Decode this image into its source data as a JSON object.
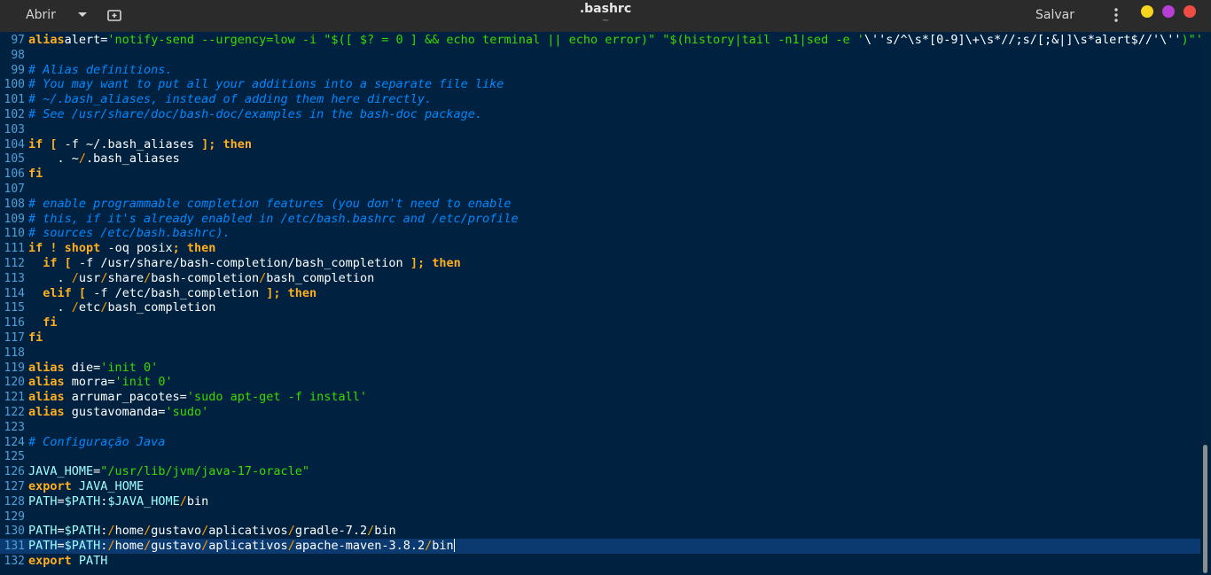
{
  "header": {
    "open_label": "Abrir",
    "title": ".bashrc",
    "subtitle": "~",
    "save_label": "Salvar",
    "icons": {
      "dropdown": "chevron-down-icon",
      "new_tab": "new-tab-icon",
      "menu": "vertical-dots-menu-icon"
    },
    "window_colors": {
      "minimize": "#f5d51d",
      "maximize": "#b73ed6",
      "close": "#ee4d45"
    }
  },
  "editor": {
    "colors": {
      "background": "#002240",
      "keyword": "#ffae1f",
      "string": "#3ad900",
      "comment": "#0088ff",
      "line_number": "#4fa0d8",
      "current_line": "#0b3a70"
    },
    "current_line": 131,
    "lines": [
      {
        "n": "97",
        "segs": [
          [
            "k",
            "alias"
          ],
          [
            "",
            "alert="
          ],
          [
            "s",
            "'notify-send --urgency=low -i \"$([ $? = 0 ] && echo terminal || echo error)\" \"$(history|tail -n1|sed -e '"
          ],
          [
            "",
            "\\''s/^\\s*[0-9]\\+\\s*//;s/[;&|]\\s*alert$//'\\''"
          ],
          [
            "s",
            ")\"'"
          ]
        ]
      },
      {
        "n": "98",
        "segs": []
      },
      {
        "n": "99",
        "segs": [
          [
            "c",
            "# Alias definitions."
          ]
        ]
      },
      {
        "n": "100",
        "segs": [
          [
            "c",
            "# You may want to put all your additions into a separate file like"
          ]
        ]
      },
      {
        "n": "101",
        "segs": [
          [
            "c",
            "# ~/.bash_aliases, instead of adding them here directly."
          ]
        ]
      },
      {
        "n": "102",
        "segs": [
          [
            "c",
            "# See /usr/share/doc/bash-doc/examples in the bash-doc package."
          ]
        ]
      },
      {
        "n": "103",
        "segs": []
      },
      {
        "n": "104",
        "segs": [
          [
            "k",
            "if"
          ],
          [
            "",
            " "
          ],
          [
            "k",
            "["
          ],
          [
            "",
            " -f ~/.bash_aliases "
          ],
          [
            "k",
            "]; then"
          ]
        ]
      },
      {
        "n": "105",
        "segs": [
          [
            "",
            "    . ~"
          ],
          [
            "sl",
            "/"
          ],
          [
            "",
            ".bash_aliases"
          ]
        ]
      },
      {
        "n": "106",
        "segs": [
          [
            "k",
            "fi"
          ]
        ]
      },
      {
        "n": "107",
        "segs": []
      },
      {
        "n": "108",
        "segs": [
          [
            "c",
            "# enable programmable completion features (you don't need to enable"
          ]
        ]
      },
      {
        "n": "109",
        "segs": [
          [
            "c",
            "# this, if it's already enabled in /etc/bash.bashrc and /etc/profile"
          ]
        ]
      },
      {
        "n": "110",
        "segs": [
          [
            "c",
            "# sources /etc/bash.bashrc)."
          ]
        ]
      },
      {
        "n": "111",
        "segs": [
          [
            "k",
            "if"
          ],
          [
            "",
            " "
          ],
          [
            "k",
            "! shopt"
          ],
          [
            "",
            " -oq posix"
          ],
          [
            "k",
            "; then"
          ]
        ]
      },
      {
        "n": "112",
        "segs": [
          [
            "",
            "  "
          ],
          [
            "k",
            "if"
          ],
          [
            "",
            " "
          ],
          [
            "k",
            "["
          ],
          [
            "",
            " -f /usr/share/bash-completion/bash_completion "
          ],
          [
            "k",
            "]; then"
          ]
        ]
      },
      {
        "n": "113",
        "segs": [
          [
            "",
            "    . "
          ],
          [
            "sl",
            "/"
          ],
          [
            "",
            "usr"
          ],
          [
            "sl",
            "/"
          ],
          [
            "",
            "share"
          ],
          [
            "sl",
            "/"
          ],
          [
            "",
            "bash-completion"
          ],
          [
            "sl",
            "/"
          ],
          [
            "",
            "bash_completion"
          ]
        ]
      },
      {
        "n": "114",
        "segs": [
          [
            "",
            "  "
          ],
          [
            "k",
            "elif"
          ],
          [
            "",
            " "
          ],
          [
            "k",
            "["
          ],
          [
            "",
            " -f /etc/bash_completion "
          ],
          [
            "k",
            "]; then"
          ]
        ]
      },
      {
        "n": "115",
        "segs": [
          [
            "",
            "    . "
          ],
          [
            "sl",
            "/"
          ],
          [
            "",
            "etc"
          ],
          [
            "sl",
            "/"
          ],
          [
            "",
            "bash_completion"
          ]
        ]
      },
      {
        "n": "116",
        "segs": [
          [
            "",
            "  "
          ],
          [
            "k",
            "fi"
          ]
        ]
      },
      {
        "n": "117",
        "segs": [
          [
            "k",
            "fi"
          ]
        ]
      },
      {
        "n": "118",
        "segs": []
      },
      {
        "n": "119",
        "segs": [
          [
            "k",
            "alias"
          ],
          [
            "",
            " die="
          ],
          [
            "s",
            "'init 0'"
          ]
        ]
      },
      {
        "n": "120",
        "segs": [
          [
            "k",
            "alias"
          ],
          [
            "",
            " morra="
          ],
          [
            "s",
            "'init 0'"
          ]
        ]
      },
      {
        "n": "121",
        "segs": [
          [
            "k",
            "alias"
          ],
          [
            "",
            " arrumar_pacotes="
          ],
          [
            "s",
            "'sudo apt-get -f install'"
          ]
        ]
      },
      {
        "n": "122",
        "segs": [
          [
            "k",
            "alias"
          ],
          [
            "",
            " gustavomanda="
          ],
          [
            "s",
            "'sudo'"
          ]
        ]
      },
      {
        "n": "123",
        "segs": []
      },
      {
        "n": "124",
        "segs": [
          [
            "c",
            "# Configuração Java"
          ]
        ]
      },
      {
        "n": "125",
        "segs": []
      },
      {
        "n": "126",
        "segs": [
          [
            "v",
            "JAVA_HOME"
          ],
          [
            "",
            "="
          ],
          [
            "s",
            "\"/usr/lib/jvm/java-17-oracle\""
          ]
        ]
      },
      {
        "n": "127",
        "segs": [
          [
            "k",
            "export"
          ],
          [
            "",
            " "
          ],
          [
            "v",
            "JAVA_HOME"
          ]
        ]
      },
      {
        "n": "128",
        "segs": [
          [
            "v",
            "PATH"
          ],
          [
            "",
            "="
          ],
          [
            "v",
            "$PATH"
          ],
          [
            "",
            ":"
          ],
          [
            "v",
            "$JAVA_HOME"
          ],
          [
            "sl",
            "/"
          ],
          [
            "",
            "bin"
          ]
        ]
      },
      {
        "n": "129",
        "segs": []
      },
      {
        "n": "130",
        "segs": [
          [
            "v",
            "PATH"
          ],
          [
            "",
            "="
          ],
          [
            "v",
            "$PATH"
          ],
          [
            "",
            ":"
          ],
          [
            "sl",
            "/"
          ],
          [
            "",
            "home"
          ],
          [
            "sl",
            "/"
          ],
          [
            "",
            "gustavo"
          ],
          [
            "sl",
            "/"
          ],
          [
            "",
            "aplicativos"
          ],
          [
            "sl",
            "/"
          ],
          [
            "",
            "gradle-7.2"
          ],
          [
            "sl",
            "/"
          ],
          [
            "",
            "bin"
          ]
        ]
      },
      {
        "n": "131",
        "segs": [
          [
            "v",
            "PATH"
          ],
          [
            "",
            "="
          ],
          [
            "v",
            "$PATH"
          ],
          [
            "",
            ":"
          ],
          [
            "sl",
            "/"
          ],
          [
            "",
            "home"
          ],
          [
            "sl",
            "/"
          ],
          [
            "",
            "gustavo"
          ],
          [
            "sl",
            "/"
          ],
          [
            "",
            "aplicativos"
          ],
          [
            "sl",
            "/"
          ],
          [
            "",
            "apache-maven-3.8.2"
          ],
          [
            "sl",
            "/"
          ],
          [
            "",
            "bin"
          ]
        ]
      },
      {
        "n": "132",
        "segs": [
          [
            "k",
            "export"
          ],
          [
            "",
            " "
          ],
          [
            "v",
            "PATH"
          ]
        ]
      }
    ]
  }
}
